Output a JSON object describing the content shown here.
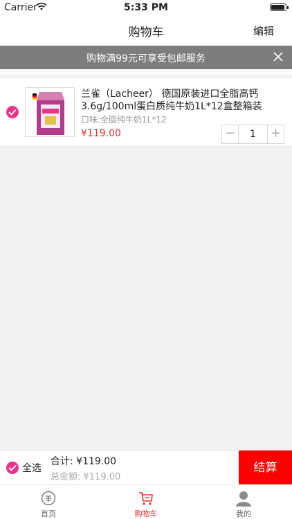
{
  "status_bar": {
    "carrier": "Carrier",
    "time": "5:33 PM"
  },
  "nav": {
    "title": "购物车",
    "edit_label": "编辑"
  },
  "promo": {
    "text": "购物满99元可享受包邮服务"
  },
  "cart_item": {
    "title": "兰雀（Lacheer） 德国原装进口全脂高钙3.6g/100ml蛋白质纯牛奶1L*12盒整箱装",
    "spec": "口味:全脂纯牛奶1L*12",
    "price": "¥119.00",
    "quantity": "1",
    "minus": "−",
    "plus": "+"
  },
  "footer": {
    "select_all_label": "全选",
    "subtotal": "合计: ¥119.00",
    "total": "总金额: ¥119.00",
    "checkout_label": "结算"
  },
  "tabs": [
    {
      "label": "首页",
      "icon": "home-icon"
    },
    {
      "label": "购物车",
      "icon": "cart-icon"
    },
    {
      "label": "我的",
      "icon": "profile-icon"
    }
  ],
  "colors": {
    "accent_pink": "#e8358a",
    "price_red": "#e62e2e",
    "checkout_red": "#ff0000",
    "promo_gray": "#7d7d7d"
  }
}
